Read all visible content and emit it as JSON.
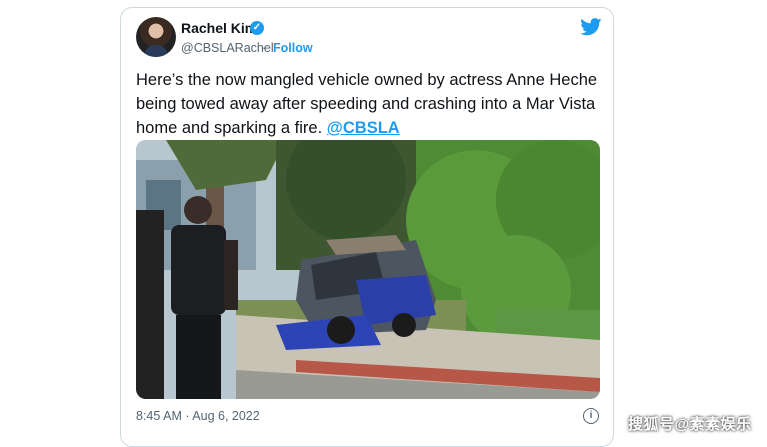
{
  "tweet": {
    "author_name": "Rachel Kim",
    "handle": "@CBSLARachel",
    "separator": "·",
    "follow_label": "Follow",
    "text_main": "Here’s the now mangled vehicle owned by actress Anne Heche being towed away after speeding and crashing into a Mar Vista home and sparking a fire.",
    "mention": "@CBSLA",
    "timestamp": "8:45 AM · Aug 6, 2022",
    "info_icon_glyph": "i",
    "verified_glyph": "✓"
  },
  "media": {
    "description_icon": "photo-crashed-vehicle"
  },
  "watermark": {
    "text": "搜狐号@素素娱乐"
  },
  "colors": {
    "accent": "#1d9bf0",
    "text": "#0f1419",
    "muted": "#536471",
    "border": "#cfd9de"
  }
}
